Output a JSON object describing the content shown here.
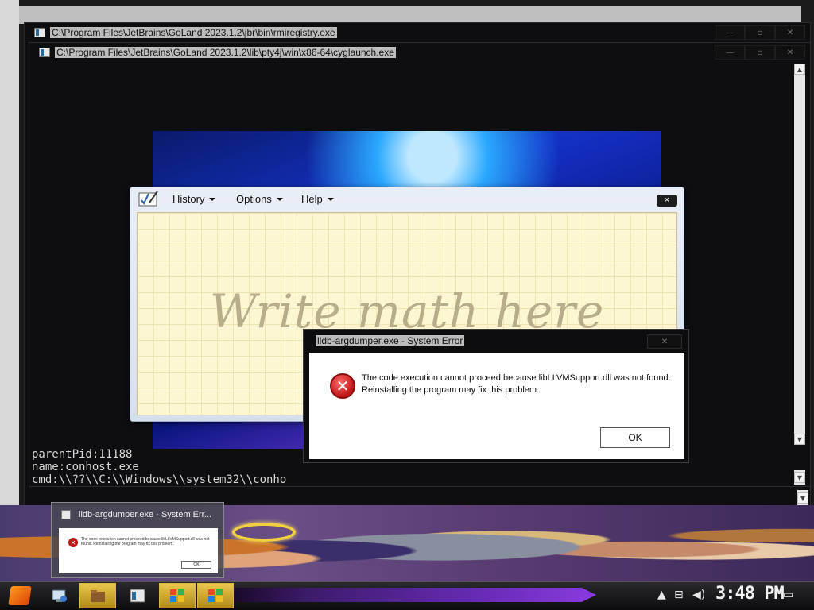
{
  "windows": {
    "rmiregistry": {
      "title": "C:\\Program Files\\JetBrains\\GoLand 2023.1.2\\jbr\\bin\\rmiregistry.exe"
    },
    "cyglaunch": {
      "title": "C:\\Program Files\\JetBrains\\GoLand 2023.1.2\\lib\\pty4j\\win\\x86-64\\cyglaunch.exe",
      "lines": [
        "parentPid:11188",
        "name:conhost.exe",
        "cmd:\\\\??\\\\C:\\\\Windows\\\\system32\\\\conho"
      ]
    }
  },
  "math_panel": {
    "menu": {
      "history": "History",
      "options": "Options",
      "help": "Help"
    },
    "close_glyph": "✕",
    "placeholder": "Write math here"
  },
  "error_dialog": {
    "title": "lldb-argdumper.exe - System Error",
    "message": "The code execution cannot proceed because libLLVMSupport.dll was not found. Reinstalling the program may fix this problem.",
    "ok_label": "OK",
    "close_glyph": "✕"
  },
  "taskbar_preview": {
    "title": "lldb-argdumper.exe - System Err...",
    "message": "The code execution cannot proceed because libLLVMSupport.dll was not found. Reinstalling the program may fix this problem.",
    "ok_label": "OK"
  },
  "taskbar": {
    "clock": "3:48 PM",
    "tray": {
      "chevron": "▲",
      "network": "⊟",
      "volume": "◀)",
      "notification": "▭"
    }
  },
  "window_buttons": {
    "minimize": "—",
    "maximize": "▫",
    "close": "✕"
  },
  "colors": {
    "accent": "#e8c84a",
    "error": "#c01616",
    "taskbar": "#1b1b1e"
  }
}
